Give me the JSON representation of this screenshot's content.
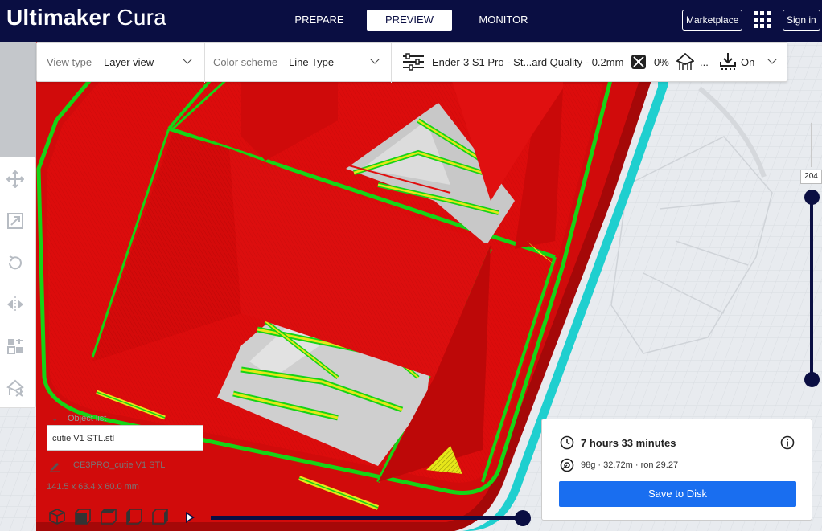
{
  "app": {
    "title_bold": "Ultimaker",
    "title_light": "Cura"
  },
  "nav": {
    "tabs": [
      {
        "label": "PREPARE",
        "active": false
      },
      {
        "label": "PREVIEW",
        "active": true
      },
      {
        "label": "MONITOR",
        "active": false
      }
    ],
    "marketplace": "Marketplace",
    "sign_in": "Sign in"
  },
  "toolbar": {
    "view_type_label": "View type",
    "view_type_value": "Layer view",
    "color_scheme_label": "Color scheme",
    "color_scheme_value": "Line Type",
    "profile": "Ender-3 S1 Pro - St...ard Quality - 0.2mm",
    "infill": "0%",
    "support": "...",
    "adhesion": "On"
  },
  "object_list": {
    "label": "Object list",
    "selected_file": "cutie V1 STL.stl",
    "file_name": "CE3PRO_cutie V1 STL",
    "dimensions": "141.5 x 63.4 x 60.0 mm"
  },
  "layer_slider": {
    "current_layer": "204"
  },
  "print_summary": {
    "time": "7 hours 33 minutes",
    "material": "98g · 32.72m · ron 29.27",
    "save_label": "Save to Disk"
  },
  "colors": {
    "header": "#0a0e42",
    "accent": "#196ef0",
    "wall_outer": "#e10d0d",
    "wall_inner": "#16d416",
    "infill": "#e6e619",
    "skirt": "#29e8e8"
  }
}
